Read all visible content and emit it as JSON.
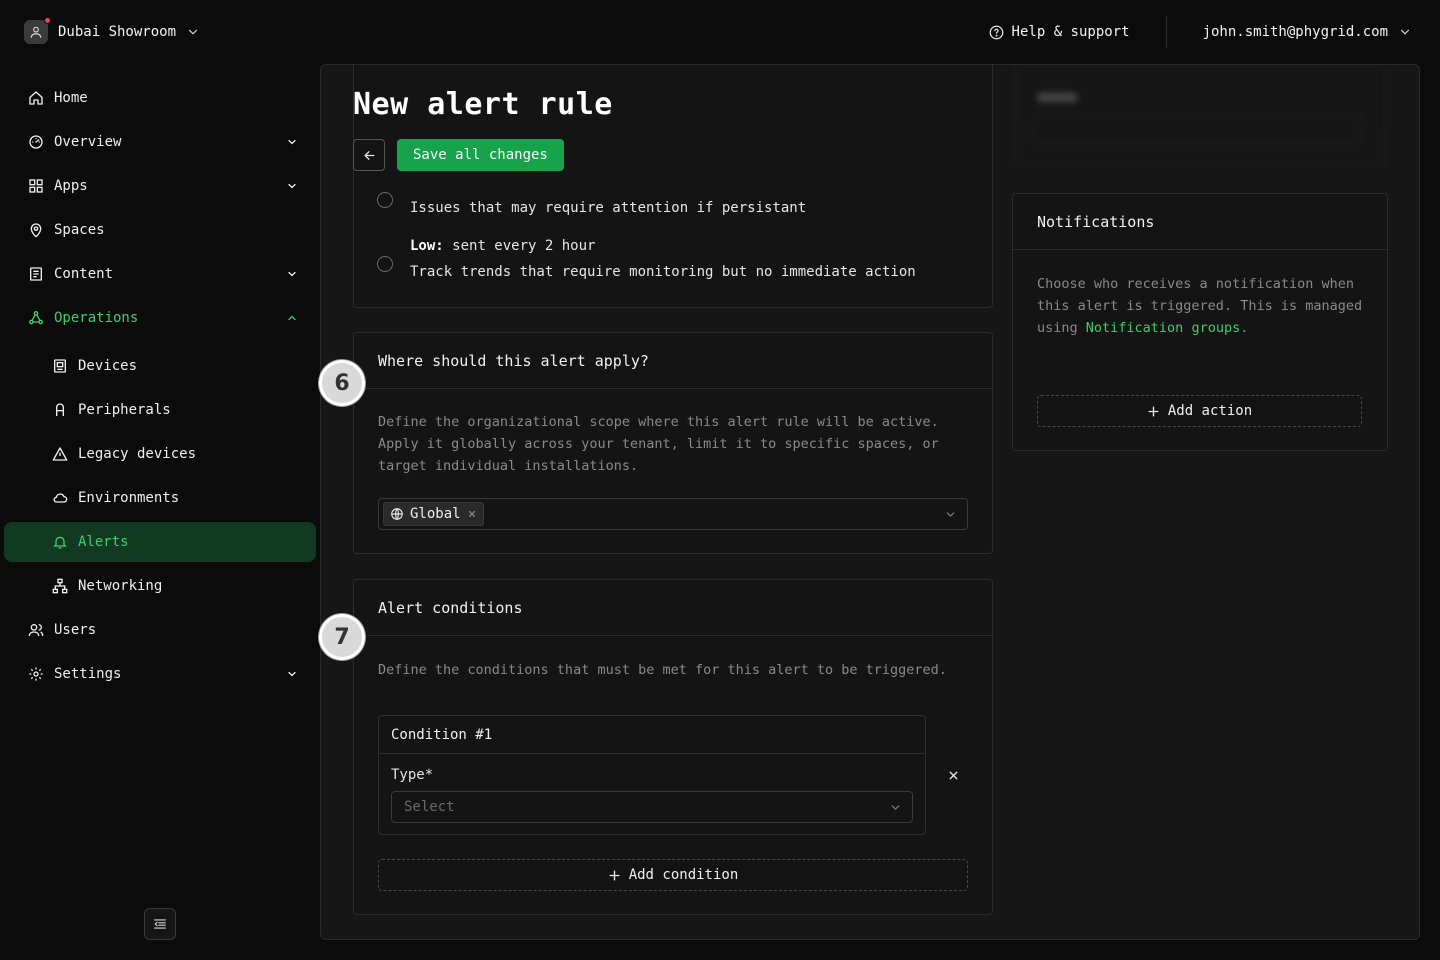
{
  "workspace": {
    "name": "Dubai Showroom"
  },
  "header": {
    "help_label": "Help & support",
    "user_email": "john.smith@phygrid.com"
  },
  "sidebar": {
    "items": [
      {
        "label": "Home"
      },
      {
        "label": "Overview"
      },
      {
        "label": "Apps"
      },
      {
        "label": "Spaces"
      },
      {
        "label": "Content"
      },
      {
        "label": "Operations"
      },
      {
        "label": "Devices"
      },
      {
        "label": "Peripherals"
      },
      {
        "label": "Legacy devices"
      },
      {
        "label": "Environments"
      },
      {
        "label": "Alerts"
      },
      {
        "label": "Networking"
      },
      {
        "label": "Users"
      },
      {
        "label": "Settings"
      }
    ]
  },
  "page": {
    "title": "New alert rule",
    "save_label": "Save all changes"
  },
  "severity": {
    "medium_description": "Issues that may require attention if persistant",
    "low_name": "Low:",
    "low_frequency": "sent every 2 hour",
    "low_description": "Track trends that require monitoring but no immediate action"
  },
  "scope": {
    "step": "6",
    "title": "Where should this alert apply?",
    "description": "Define the organizational scope where this alert rule will be active. Apply it globally across your tenant, limit it to specific spaces, or target individual installations.",
    "selected": "Global"
  },
  "conditions": {
    "step": "7",
    "title": "Alert conditions",
    "description": "Define the conditions that must be met for this alert to be triggered.",
    "condition_title": "Condition #1",
    "type_label": "Type",
    "type_required": "*",
    "type_placeholder": "Select",
    "add_label": "Add condition"
  },
  "notifications": {
    "title": "Notifications",
    "description_prefix": "Choose who receives a notification when this alert is triggered. This is managed using ",
    "link_label": "Notification groups",
    "description_suffix": ".",
    "add_action_label": "Add action"
  },
  "colors": {
    "accent": "#3ccf6b",
    "primary_button": "#17a34a",
    "active_bg": "#123a22"
  }
}
